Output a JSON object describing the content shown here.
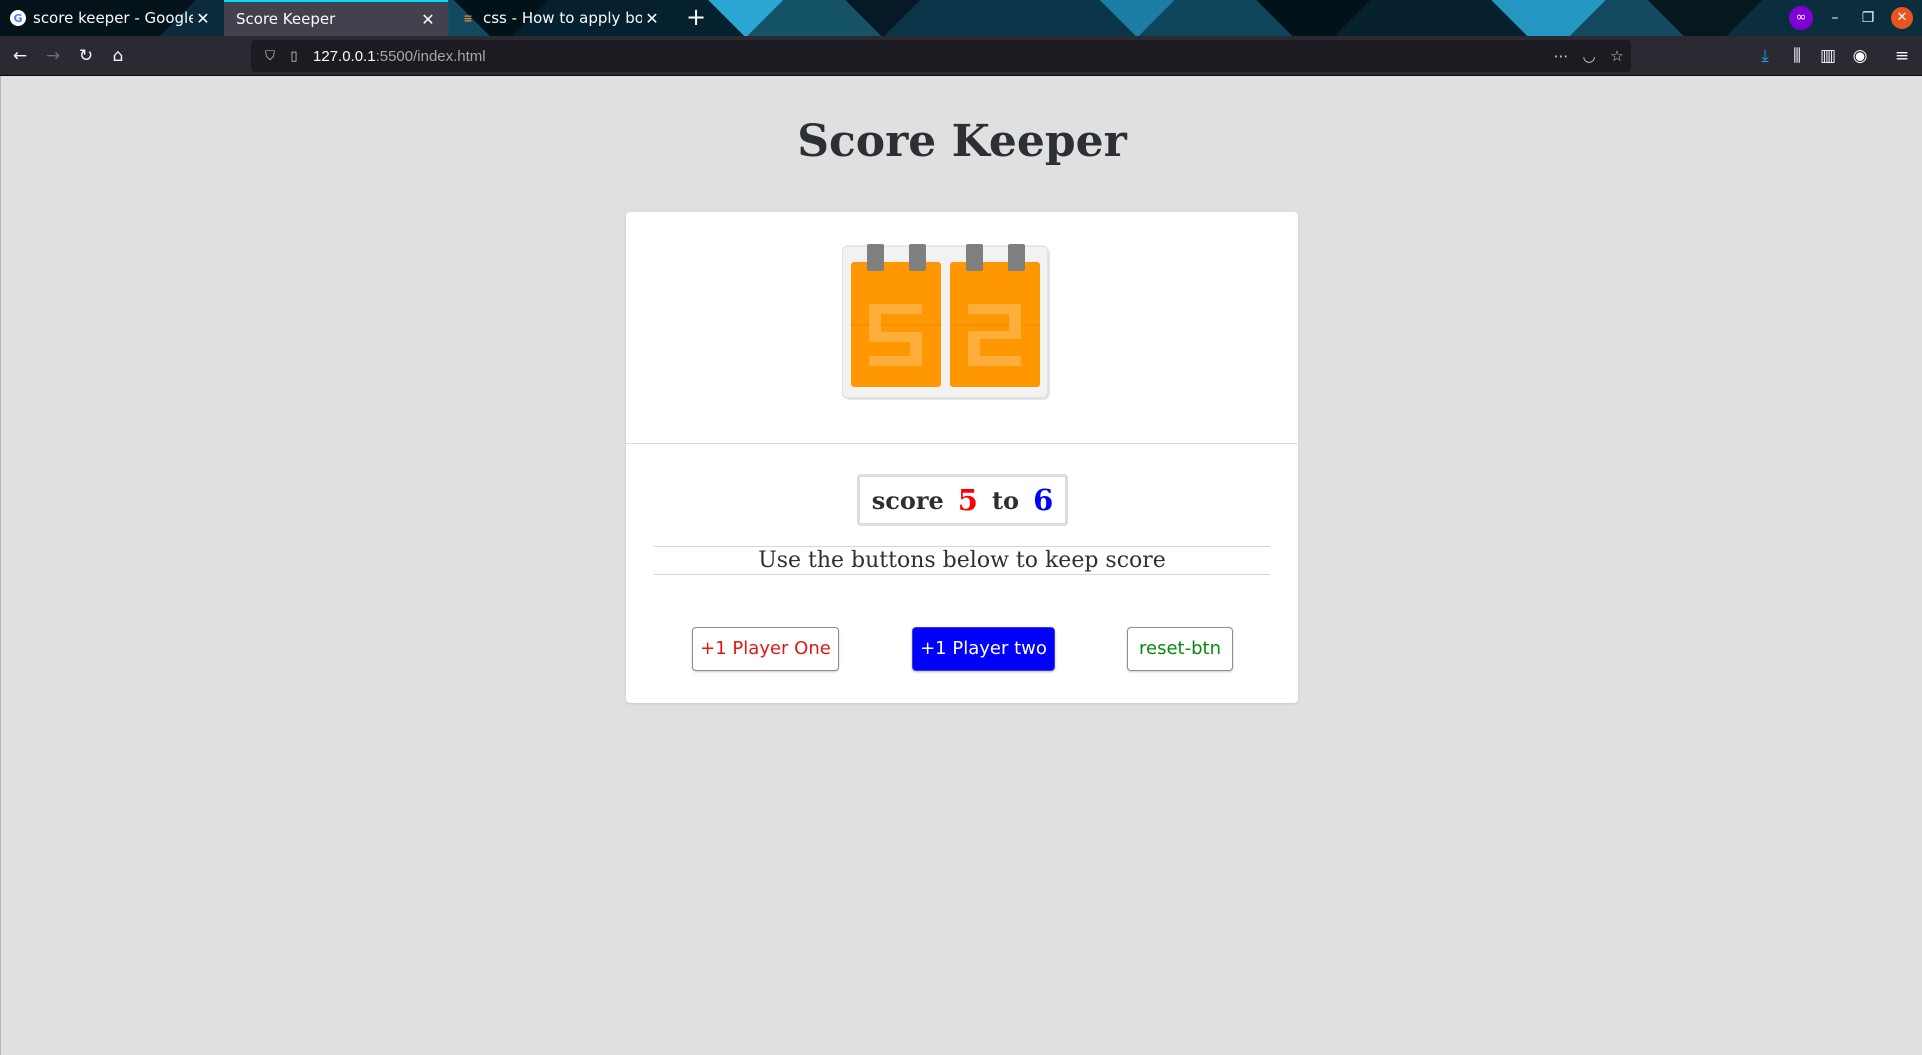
{
  "browser": {
    "tabs": [
      {
        "title": "score keeper - Google Se",
        "favicon": "google-favicon"
      },
      {
        "title": "Score Keeper",
        "favicon": "none",
        "active": true
      },
      {
        "title": "css - How to apply box-s",
        "favicon": "stackoverflow-favicon"
      }
    ],
    "tab_close_glyph": "✕",
    "new_tab_glyph": "+",
    "url_host": "127.0.0.1",
    "url_rest": ":5500/index.html",
    "colors": {
      "accent": "#00ddff",
      "private": "#8000d7",
      "close": "#e95420"
    }
  },
  "page": {
    "title": "Score Keeper",
    "score": {
      "label": "score",
      "player_one": "5",
      "connector": "to",
      "player_two": "6",
      "colors": {
        "player_one": "#ff0000",
        "player_two": "#0000ff"
      }
    },
    "instructions": "Use the buttons below to keep score",
    "buttons": {
      "player_one": "+1 Player One",
      "player_two": "+1 Player two",
      "reset": "reset-btn"
    },
    "image_icon": "scoreboard-flip-card-icon"
  }
}
